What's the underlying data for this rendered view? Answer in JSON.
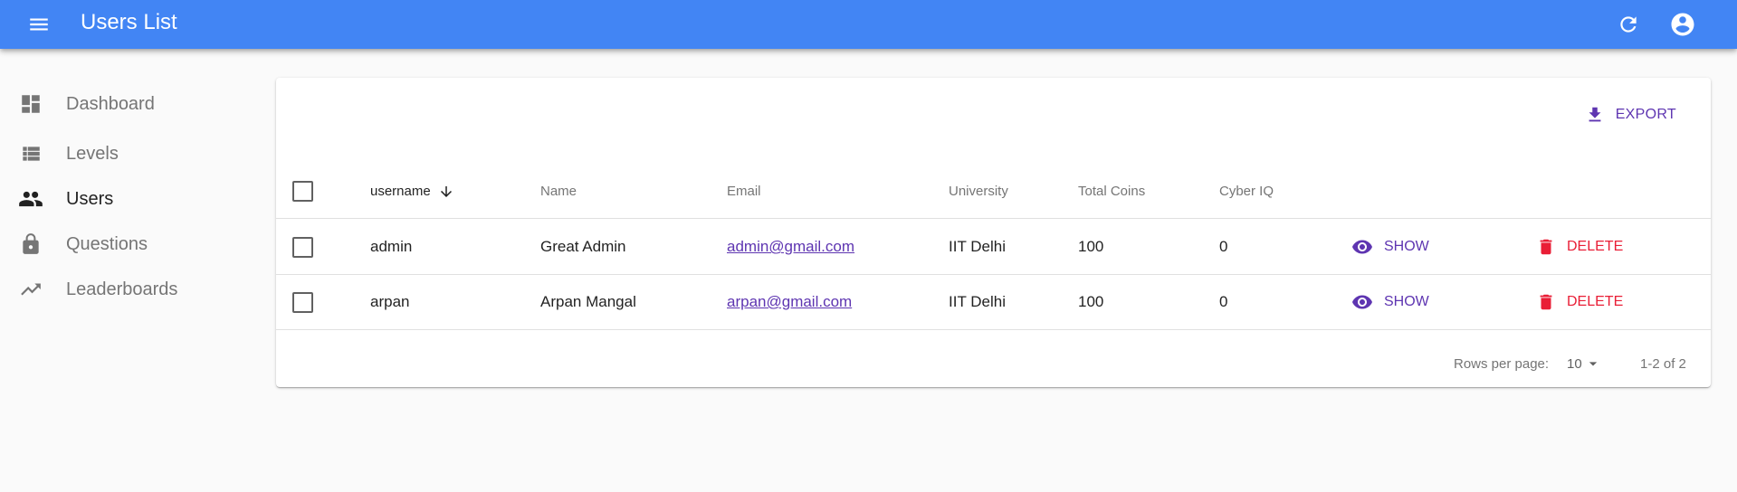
{
  "appbar": {
    "title": "Users List",
    "menu_icon": "menu-icon",
    "refresh_icon": "refresh-icon",
    "account_icon": "account-circle-icon",
    "background": "#4285f4"
  },
  "sidebar": {
    "items": [
      {
        "label": "Dashboard",
        "icon": "dashboard-icon",
        "active": false
      },
      {
        "label": "Levels",
        "icon": "list-icon",
        "active": false
      },
      {
        "label": "Users",
        "icon": "people-icon",
        "active": true
      },
      {
        "label": "Questions",
        "icon": "lock-icon",
        "active": false
      },
      {
        "label": "Leaderboards",
        "icon": "trending-up-icon",
        "active": false
      }
    ]
  },
  "toolbar": {
    "export_label": "EXPORT",
    "export_icon": "download-icon"
  },
  "table": {
    "columns": {
      "username": "username",
      "name": "Name",
      "email": "Email",
      "university": "University",
      "total_coins": "Total Coins",
      "cyber_iq": "Cyber IQ"
    },
    "sorted_column": "username",
    "sort_direction": "descending",
    "rows": [
      {
        "username": "admin",
        "name": "Great Admin",
        "email": "admin@gmail.com",
        "university": "IIT Delhi",
        "total_coins": "100",
        "cyber_iq": "0",
        "show_label": "SHOW",
        "delete_label": "DELETE"
      },
      {
        "username": "arpan",
        "name": "Arpan Mangal",
        "email": "arpan@gmail.com",
        "university": "IIT Delhi",
        "total_coins": "100",
        "cyber_iq": "0",
        "show_label": "SHOW",
        "delete_label": "DELETE"
      }
    ]
  },
  "pagination": {
    "rows_per_page_label": "Rows per page:",
    "rows_per_page_value": "10",
    "range": "1-2 of 2"
  },
  "colors": {
    "accent": "#5e35b1",
    "danger": "#e91e36"
  }
}
